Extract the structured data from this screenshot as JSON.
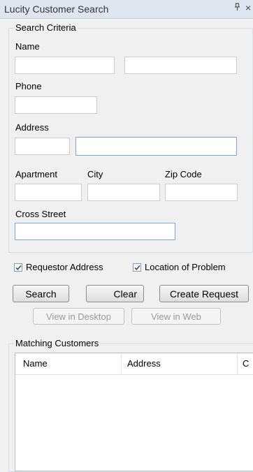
{
  "window": {
    "title": "Lucity Customer Search",
    "pin_glyph": "ᵖ",
    "close_glyph": "×"
  },
  "search_criteria": {
    "legend": "Search Criteria",
    "name_label": "Name",
    "phone_label": "Phone",
    "address_label": "Address",
    "apartment_label": "Apartment",
    "city_label": "City",
    "zip_label": "Zip Code",
    "cross_street_label": "Cross Street",
    "values": {
      "first_name": "",
      "last_name": "",
      "phone": "",
      "address_number": "",
      "address_street": "",
      "apartment": "",
      "city": "",
      "zip": "",
      "cross_street": ""
    }
  },
  "options": {
    "requestor_address": {
      "label": "Requestor Address",
      "checked": true
    },
    "location_of_problem": {
      "label": "Location of Problem",
      "checked": true
    }
  },
  "buttons": {
    "search": "Search",
    "clear": "Clear",
    "create_request": "Create Request",
    "view_desktop": "View in Desktop",
    "view_web": "View in Web"
  },
  "matching": {
    "legend": "Matching Customers",
    "columns": [
      "Name",
      "Address",
      "C"
    ],
    "rows": []
  },
  "colors": {
    "titlebar": "#dfe6ef",
    "focus_border": "#7aa7d8",
    "background": "#f0f0f0"
  }
}
